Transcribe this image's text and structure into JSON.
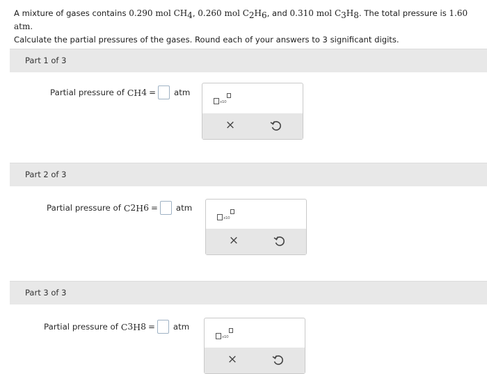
{
  "problem": {
    "s1": "A mixture of gases contains ",
    "m1": "0.290 mol CH",
    "sub1": "4",
    "s2": ", ",
    "m2": "0.260 mol C",
    "sub2a": "2",
    "m2b": "H",
    "sub2b": "6",
    "s3": ", and ",
    "m3": "0.310 mol C",
    "sub3a": "3",
    "m3b": "H",
    "sub3b": "8",
    "s4": ". The total pressure is ",
    "m4": "1.60 atm",
    "s5": ".",
    "line2": "Calculate the partial pressures of the gases. Round each of your answers to 3 significant digits."
  },
  "parts": [
    {
      "header": "Part 1 of 3",
      "label": "Partial pressure of ",
      "chem_a": "CH",
      "sub_a": "4",
      "chem_b": "",
      "sub_b": "",
      "eq": "=",
      "unit": "atm",
      "tool_x": "×"
    },
    {
      "header": "Part 2 of 3",
      "label": "Partial pressure of ",
      "chem_a": "C",
      "sub_a": "2",
      "chem_b": "H",
      "sub_b": "6",
      "eq": "=",
      "unit": "atm",
      "tool_x": "×"
    },
    {
      "header": "Part 3 of 3",
      "label": "Partial pressure of ",
      "chem_a": "C",
      "sub_a": "3",
      "chem_b": "H",
      "sub_b": "8",
      "eq": "=",
      "unit": "atm",
      "tool_x": "×"
    }
  ],
  "sci_notation_label": "x10",
  "icons": {
    "sci": "scientific-notation-icon",
    "clear": "clear-x-icon",
    "undo": "undo-icon"
  }
}
